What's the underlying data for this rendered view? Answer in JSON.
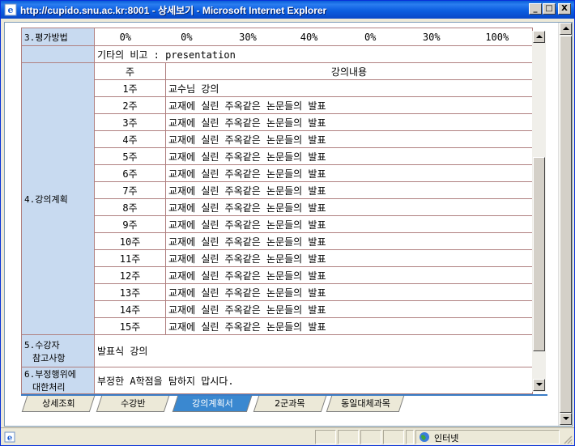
{
  "window": {
    "title": "http://cupido.snu.ac.kr:8001 - 상세보기 - Microsoft Internet Explorer",
    "controls": [
      "_",
      "□",
      "X"
    ]
  },
  "evaluation": {
    "label": "3.평가방법",
    "values": [
      "0%",
      "0%",
      "30%",
      "40%",
      "0%",
      "30%",
      "100%"
    ],
    "note": "기타의 비고 : presentation"
  },
  "plan": {
    "label": "4.강의계획",
    "col_week": "주",
    "col_content": "강의내용",
    "rows": [
      {
        "week": "1주",
        "content": "교수님 강의"
      },
      {
        "week": "2주",
        "content": "교재에 실린 주옥같은 논문들의 발표"
      },
      {
        "week": "3주",
        "content": "교재에 실린 주옥같은 논문들의 발표"
      },
      {
        "week": "4주",
        "content": "교재에 실린 주옥같은 논문들의 발표"
      },
      {
        "week": "5주",
        "content": "교재에 실린 주옥같은 논문들의 발표"
      },
      {
        "week": "6주",
        "content": "교재에 실린 주옥같은 논문들의 발표"
      },
      {
        "week": "7주",
        "content": "교재에 실린 주옥같은 논문들의 발표"
      },
      {
        "week": "8주",
        "content": "교재에 실린 주옥같은 논문들의 발표"
      },
      {
        "week": "9주",
        "content": "교재에 실린 주옥같은 논문들의 발표"
      },
      {
        "week": "10주",
        "content": "교재에 실린 주옥같은 논문들의 발표"
      },
      {
        "week": "11주",
        "content": "교재에 실린 주옥같은 논문들의 발표"
      },
      {
        "week": "12주",
        "content": "교재에 실린 주옥같은 논문들의 발표"
      },
      {
        "week": "13주",
        "content": "교재에 실린 주옥같은 논문들의 발표"
      },
      {
        "week": "14주",
        "content": "교재에 실린 주옥같은 논문들의 발표"
      },
      {
        "week": "15주",
        "content": "교재에 실린 주옥같은 논문들의 발표"
      }
    ]
  },
  "notes": {
    "label_line1": "5.수강자",
    "label_line2": "참고사항",
    "value": "발표식 강의"
  },
  "misconduct": {
    "label_line1": "6.부정행위에",
    "label_line2": "대한처리",
    "value": "부정한 A학점을 탐하지 맙시다."
  },
  "tabs": [
    "상세조회",
    "수강반",
    "강의계획서",
    "2군과목",
    "동일대체과목"
  ],
  "active_tab": "강의계획서",
  "status": {
    "zone": "인터넷"
  },
  "colors": {
    "label_bg": "#c8daf0",
    "active_tab": "#3a88d0",
    "titlebar": "#0a5fd8"
  }
}
